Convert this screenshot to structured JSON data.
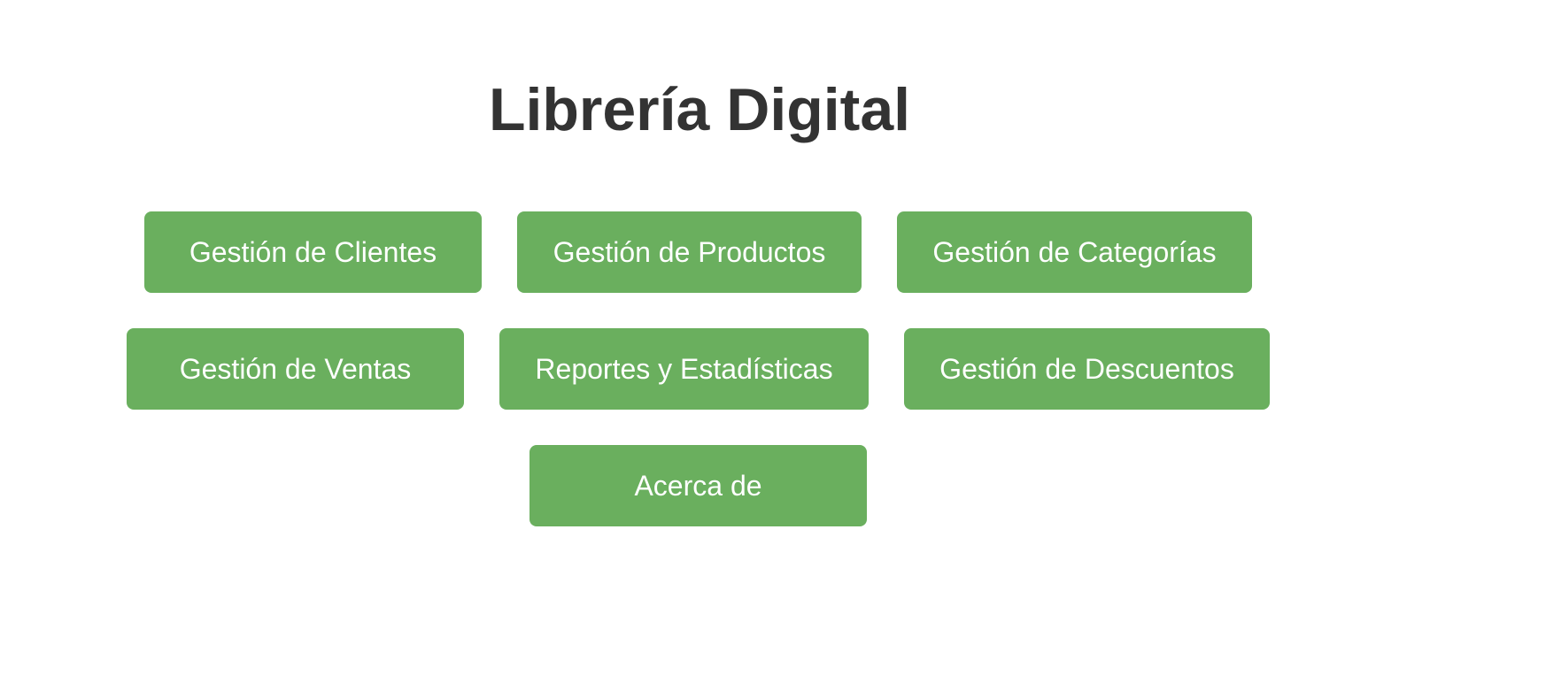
{
  "header": {
    "title": "Librería Digital"
  },
  "menu": {
    "clientes": "Gestión de Clientes",
    "productos": "Gestión de Productos",
    "categorias": "Gestión de Categorías",
    "ventas": "Gestión de Ventas",
    "reportes": "Reportes y Estadísticas",
    "descuentos": "Gestión de Descuentos",
    "acerca": "Acerca de"
  },
  "theme": {
    "button_color": "#6aaf5e",
    "button_text_color": "#ffffff",
    "title_color": "#333333",
    "background": "#ffffff"
  }
}
